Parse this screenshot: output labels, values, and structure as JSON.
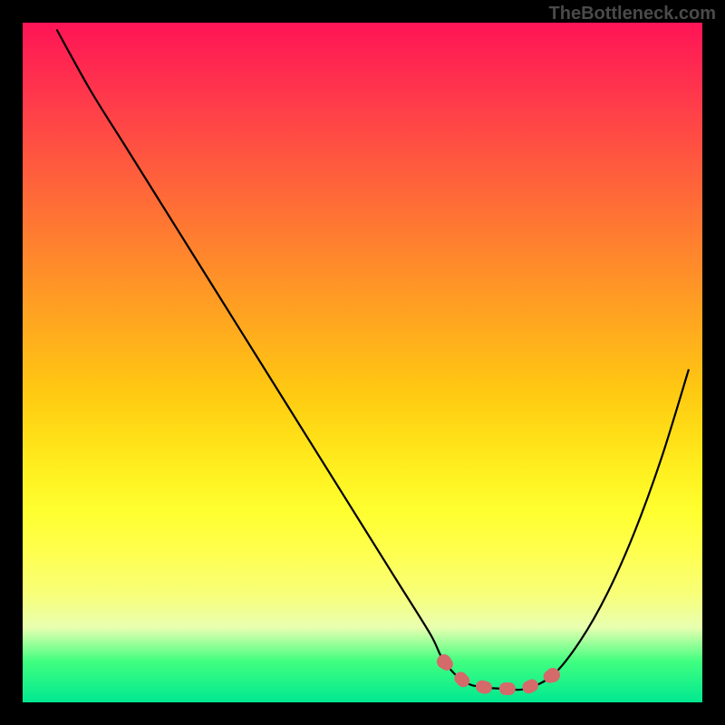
{
  "watermark": "TheBottleneck.com",
  "chart_data": {
    "type": "line",
    "title": "",
    "xlabel": "",
    "ylabel": "",
    "xlim": [
      0,
      100
    ],
    "ylim": [
      0,
      100
    ],
    "series": [
      {
        "name": "bottleneck-curve",
        "x": [
          5,
          10,
          15,
          20,
          25,
          30,
          35,
          40,
          45,
          50,
          55,
          60,
          62,
          65,
          68,
          71,
          74,
          78,
          82,
          86,
          90,
          94,
          98
        ],
        "values": [
          99,
          90,
          82,
          74,
          66,
          58,
          50,
          42,
          34,
          26,
          18,
          10,
          6,
          3,
          2.2,
          2,
          2,
          4,
          9,
          16,
          25,
          36,
          49
        ]
      }
    ],
    "annotations": [
      {
        "name": "minimum-band",
        "x_start": 62,
        "x_end": 78,
        "style": "red-dashed"
      }
    ]
  }
}
